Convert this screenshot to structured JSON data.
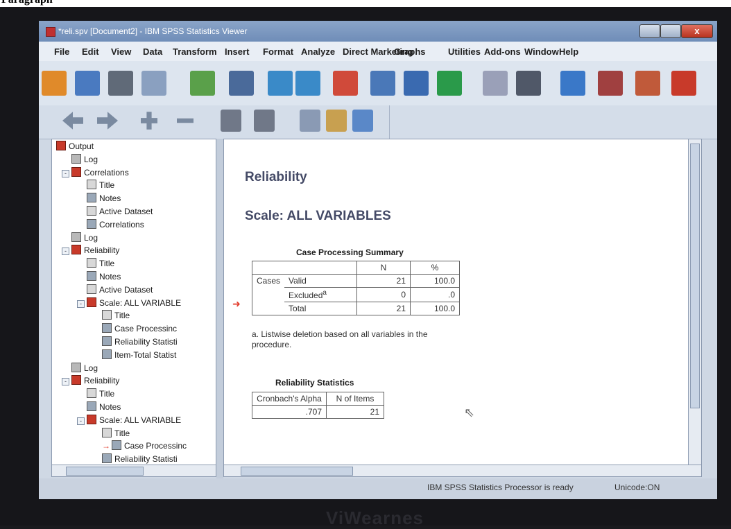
{
  "heading": "Paragraph",
  "window": {
    "title": "*reli.spv [Document2] - IBM SPSS Statistics Viewer",
    "close": "x"
  },
  "menu": [
    "File",
    "Edit",
    "View",
    "Data",
    "Transform",
    "Insert",
    "Format",
    "Analyze",
    "Direct Marketing",
    "Graphs",
    "Utilities",
    "Add-ons",
    "Window",
    "Help"
  ],
  "toolbar_icons": [
    "open-icon",
    "save-icon",
    "print-icon",
    "print-preview-icon",
    "export-icon",
    "recall-dialog-icon",
    "undo-icon",
    "redo-icon",
    "goto-case-icon",
    "goto-variable-icon",
    "variables-icon",
    "insert-cases-icon",
    "split-file-icon",
    "weight-cases-icon",
    "select-cases-icon",
    "value-labels-icon",
    "designate-window-icon",
    "spelling-icon"
  ],
  "outline": [
    {
      "label": "Output",
      "icon": "book",
      "level": 0
    },
    {
      "label": "Log",
      "icon": "log",
      "level": 1
    },
    {
      "label": "Correlations",
      "icon": "book",
      "level": 1,
      "toggle": "-"
    },
    {
      "label": "Title",
      "icon": "doc",
      "level": 2
    },
    {
      "label": "Notes",
      "icon": "tbl",
      "level": 2
    },
    {
      "label": "Active Dataset",
      "icon": "doc",
      "level": 2
    },
    {
      "label": "Correlations",
      "icon": "tbl",
      "level": 2
    },
    {
      "label": "Log",
      "icon": "log",
      "level": 1
    },
    {
      "label": "Reliability",
      "icon": "book",
      "level": 1,
      "toggle": "-"
    },
    {
      "label": "Title",
      "icon": "doc",
      "level": 2
    },
    {
      "label": "Notes",
      "icon": "tbl",
      "level": 2
    },
    {
      "label": "Active Dataset",
      "icon": "doc",
      "level": 2
    },
    {
      "label": "Scale: ALL VARIABLE",
      "icon": "book",
      "level": 2,
      "toggle": "-"
    },
    {
      "label": "Title",
      "icon": "doc",
      "level": 3
    },
    {
      "label": "Case Processinc",
      "icon": "tbl",
      "level": 3
    },
    {
      "label": "Reliability Statisti",
      "icon": "tbl",
      "level": 3
    },
    {
      "label": "Item-Total Statist",
      "icon": "tbl",
      "level": 3
    },
    {
      "label": "Log",
      "icon": "log",
      "level": 1
    },
    {
      "label": "Reliability",
      "icon": "book",
      "level": 1,
      "toggle": "-"
    },
    {
      "label": "Title",
      "icon": "doc",
      "level": 2
    },
    {
      "label": "Notes",
      "icon": "tbl",
      "level": 2
    },
    {
      "label": "Scale: ALL VARIABLE",
      "icon": "book",
      "level": 2,
      "toggle": "-"
    },
    {
      "label": "Title",
      "icon": "doc",
      "level": 3
    },
    {
      "label": "Case Processinc",
      "icon": "tbl",
      "level": 3,
      "selected_arrow": true
    },
    {
      "label": "Reliability Statisti",
      "icon": "tbl",
      "level": 3
    }
  ],
  "output": {
    "title": "Reliability",
    "subtitle": "Scale: ALL VARIABLES",
    "case_summary": {
      "caption": "Case Processing Summary",
      "headers": [
        "N",
        "%"
      ],
      "group": "Cases",
      "rows": [
        {
          "label": "Valid",
          "sup": "",
          "n": "21",
          "pct": "100.0"
        },
        {
          "label": "Excluded",
          "sup": "a",
          "n": "0",
          "pct": ".0"
        },
        {
          "label": "Total",
          "sup": "",
          "n": "21",
          "pct": "100.0"
        }
      ],
      "footnote": "a. Listwise deletion based on all variables in the procedure."
    },
    "reliability": {
      "caption": "Reliability Statistics",
      "headers": [
        "Cronbach's Alpha",
        "N of Items"
      ],
      "values": [
        ".707",
        "21"
      ]
    }
  },
  "status": {
    "processor": "IBM SPSS Statistics Processor is ready",
    "unicode": "Unicode:ON"
  },
  "brand": "ViWearnes"
}
